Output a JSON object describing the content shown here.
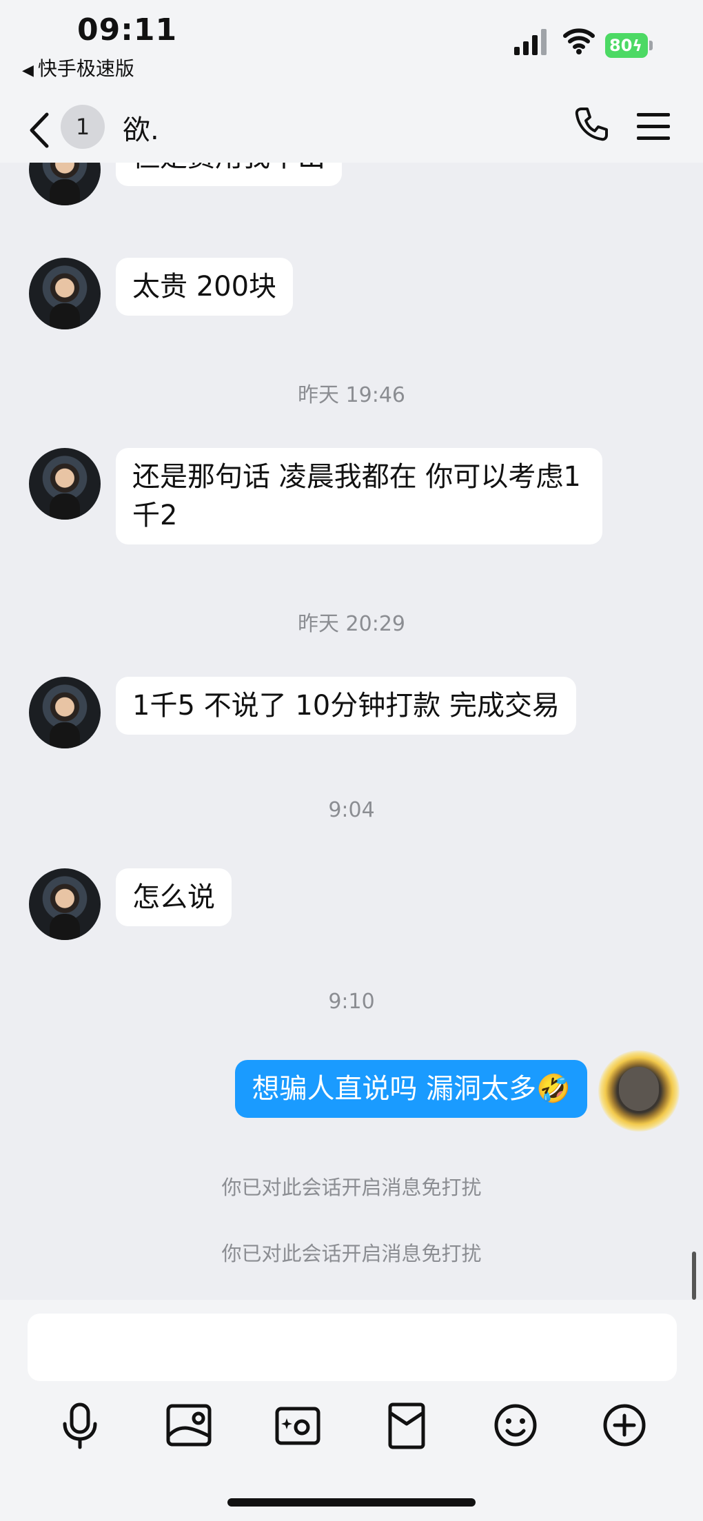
{
  "status": {
    "time": "09:11",
    "back_app": "快手极速版",
    "battery": "80"
  },
  "header": {
    "unread_count": "1",
    "title": "欲."
  },
  "messages": [
    {
      "type": "received",
      "text": "但是费用我不出"
    },
    {
      "type": "received",
      "text": "太贵 200块"
    },
    {
      "type": "timestamp",
      "text": "昨天 19:46"
    },
    {
      "type": "received",
      "text": "还是那句话 凌晨我都在 你可以考虑1千2"
    },
    {
      "type": "timestamp",
      "text": "昨天 20:29"
    },
    {
      "type": "received",
      "text": "1千5 不说了 10分钟打款 完成交易"
    },
    {
      "type": "timestamp",
      "text": "9:04"
    },
    {
      "type": "received",
      "text": "怎么说"
    },
    {
      "type": "timestamp",
      "text": "9:10"
    },
    {
      "type": "sent",
      "text": "想骗人直说吗 漏洞太多🤣"
    },
    {
      "type": "system",
      "text": "你已对此会话开启消息免打扰"
    },
    {
      "type": "system",
      "text": "你已对此会话开启消息免打扰"
    }
  ],
  "toolbar": {
    "icons": [
      "microphone-icon",
      "image-icon",
      "camera-icon",
      "red-packet-icon",
      "emoji-icon",
      "plus-icon"
    ]
  },
  "colors": {
    "background": "#edeef2",
    "sent_bubble": "#1a9bff",
    "received_bubble": "#ffffff",
    "battery": "#4cd964"
  }
}
